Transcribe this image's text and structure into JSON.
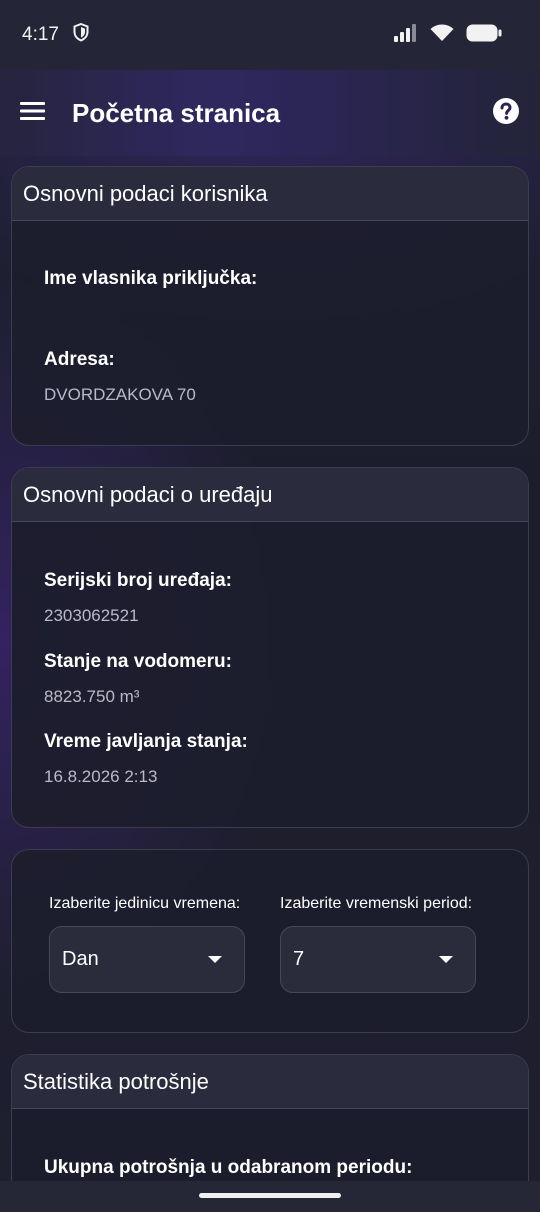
{
  "status_bar": {
    "time": "4:17",
    "icons": [
      "shield-icon",
      "signal-icon",
      "wifi-icon",
      "battery-icon"
    ]
  },
  "app_bar": {
    "title": "Početna stranica",
    "menu_icon": "hamburger-menu-icon",
    "help_icon": "help-icon"
  },
  "user_card": {
    "title": "Osnovni podaci korisnika",
    "owner_label": "Ime vlasnika priključka:",
    "owner_value": "",
    "address_label": "Adresa:",
    "address_value": "DVORDZAKOVA 70"
  },
  "device_card": {
    "title": "Osnovni podaci o uređaju",
    "serial_label": "Serijski broj uređaja:",
    "serial_value": "2303062521",
    "meter_label": "Stanje na vodomeru:",
    "meter_value": "8823.750 m³",
    "time_label": "Vreme javljanja stanja:",
    "time_value": "16.8.2026 2:13"
  },
  "filter_card": {
    "unit_label": "Izaberite jedinicu vremena:",
    "unit_value": "Dan",
    "period_label": "Izaberite vremenski period:",
    "period_value": "7"
  },
  "stats_card": {
    "title": "Statistika potrošnje",
    "total_label": "Ukupna potrošnja u odabranom periodu:"
  },
  "colors": {
    "background": "#1c1d2b",
    "card_header": "#2a2c3e",
    "secondary_text": "#b9bac6",
    "accent_purple": "#2f2860"
  }
}
